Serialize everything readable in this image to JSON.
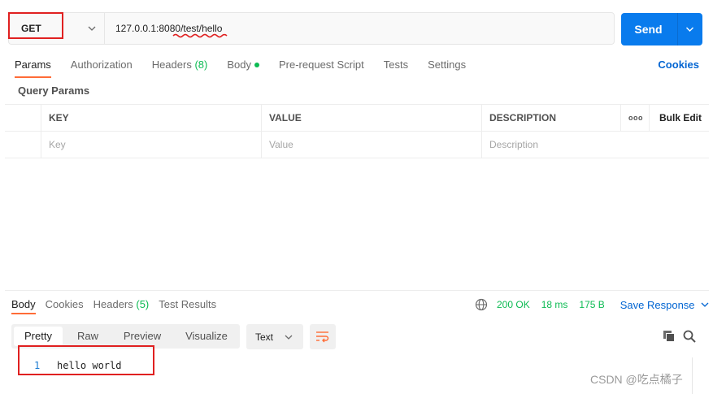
{
  "request": {
    "method": "GET",
    "url": "127.0.0.1:8080/test/hello",
    "send_label": "Send"
  },
  "request_tabs": {
    "params": "Params",
    "authorization": "Authorization",
    "headers": "Headers",
    "headers_count": "(8)",
    "body": "Body",
    "pre_request": "Pre-request Script",
    "tests": "Tests",
    "settings": "Settings",
    "cookies": "Cookies"
  },
  "query_params": {
    "title": "Query Params",
    "columns": {
      "key": "KEY",
      "value": "VALUE",
      "description": "DESCRIPTION",
      "more": "ooo",
      "bulk_edit": "Bulk Edit"
    },
    "placeholder_row": {
      "key": "Key",
      "value": "Value",
      "description": "Description"
    }
  },
  "response_tabs": {
    "body": "Body",
    "cookies": "Cookies",
    "headers": "Headers",
    "headers_count": "(5)",
    "test_results": "Test Results"
  },
  "response_status": {
    "status": "200 OK",
    "time": "18 ms",
    "size": "175 B",
    "save_response": "Save Response"
  },
  "response_view": {
    "modes": [
      "Pretty",
      "Raw",
      "Preview",
      "Visualize"
    ],
    "active_mode": "Pretty",
    "format": "Text"
  },
  "response_body": {
    "lines": [
      {
        "number": "1",
        "text": "hello world"
      }
    ]
  },
  "watermark": "CSDN @吃点橘子",
  "colors": {
    "accent_orange": "#ff6c37",
    "send_blue": "#097bed",
    "link_blue": "#0265d2",
    "success_green": "#0cbb52",
    "annotation_red": "#e02020"
  }
}
